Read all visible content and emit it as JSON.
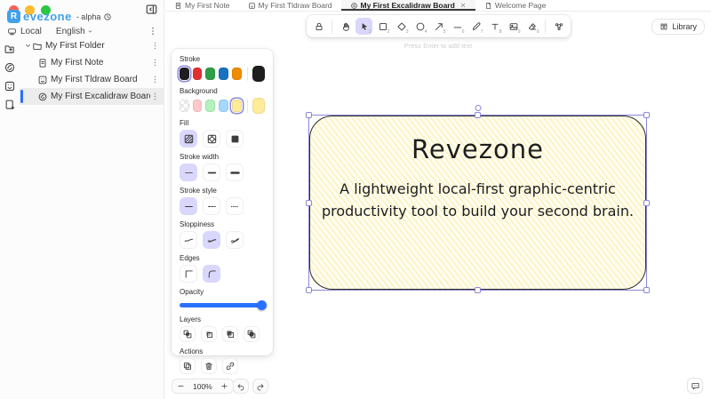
{
  "app": {
    "logo_letter": "R",
    "logo_text": "evezone",
    "version_label": "- alpha",
    "workspace_mode": "Local",
    "language": "English"
  },
  "sidebar": {
    "folder_label": "My First Folder",
    "rail_buttons": [
      {
        "name": "add-folder",
        "icon": "folder-plus"
      },
      {
        "name": "add-excalidraw",
        "icon": "excalidraw"
      },
      {
        "name": "add-tldraw",
        "icon": "tldraw"
      },
      {
        "name": "add-note",
        "icon": "note-plus"
      }
    ],
    "items": [
      {
        "label": "My First Note",
        "icon": "note",
        "selected": false
      },
      {
        "label": "My First Tldraw Board",
        "icon": "tldraw",
        "selected": false
      },
      {
        "label": "My First Excalidraw Board",
        "icon": "excalidraw",
        "selected": true
      }
    ]
  },
  "tabs": [
    {
      "label": "My First Note",
      "icon": "note",
      "active": false,
      "closable": false
    },
    {
      "label": "My First Tldraw Board",
      "icon": "tldraw",
      "active": false,
      "closable": false
    },
    {
      "label": "My First Excalidraw Board",
      "icon": "excalidraw",
      "active": true,
      "closable": true
    },
    {
      "label": "Welcome Page",
      "icon": "page",
      "active": false,
      "closable": false
    }
  ],
  "toolbar": {
    "left_group": [
      {
        "name": "lock",
        "icon": "lock",
        "shortcut": "",
        "active": false
      }
    ],
    "main_group": [
      {
        "name": "hand",
        "icon": "hand",
        "shortcut": "",
        "active": false
      },
      {
        "name": "selection",
        "icon": "mouse-pointer",
        "shortcut": "1",
        "active": true
      },
      {
        "name": "rectangle",
        "icon": "square",
        "shortcut": "2",
        "active": false
      },
      {
        "name": "diamond",
        "icon": "diamond",
        "shortcut": "3",
        "active": false
      },
      {
        "name": "ellipse",
        "icon": "circle",
        "shortcut": "4",
        "active": false
      },
      {
        "name": "arrow",
        "icon": "arrow",
        "shortcut": "5",
        "active": false
      },
      {
        "name": "line",
        "icon": "line",
        "shortcut": "6",
        "active": false
      },
      {
        "name": "draw",
        "icon": "pencil",
        "shortcut": "7",
        "active": false
      },
      {
        "name": "text",
        "icon": "text",
        "shortcut": "8",
        "active": false
      },
      {
        "name": "image",
        "icon": "image",
        "shortcut": "9",
        "active": false
      },
      {
        "name": "eraser",
        "icon": "eraser",
        "shortcut": "0",
        "active": false
      }
    ],
    "right_group": [
      {
        "name": "extra-tools",
        "icon": "shapes",
        "shortcut": "",
        "active": false
      }
    ],
    "library_label": "Library",
    "hint": "Press Enter to add text"
  },
  "panel": {
    "stroke": {
      "label": "Stroke",
      "swatches": [
        "#1e1e1e",
        "#e03131",
        "#2f9e44",
        "#1971c2",
        "#f08c00"
      ],
      "selected_index": 0,
      "current": "#1e1e1e"
    },
    "background": {
      "label": "Background",
      "swatches": [
        "transparent",
        "#ffc9c9",
        "#b2f2bb",
        "#a5d8ff",
        "#ffec99"
      ],
      "selected_index": 4,
      "current": "#ffec99"
    },
    "fill": {
      "label": "Fill",
      "options": [
        {
          "name": "hachure",
          "icon": "fill-hachure",
          "active": true
        },
        {
          "name": "cross-hatch",
          "icon": "fill-cross",
          "active": false
        },
        {
          "name": "solid",
          "icon": "fill-solid",
          "active": false
        }
      ]
    },
    "stroke_width": {
      "label": "Stroke width",
      "options": [
        {
          "name": "thin",
          "icon": "width-thin",
          "active": true
        },
        {
          "name": "bold",
          "icon": "width-bold",
          "active": false
        },
        {
          "name": "extra-bold",
          "icon": "width-extrabold",
          "active": false
        }
      ]
    },
    "stroke_style": {
      "label": "Stroke style",
      "options": [
        {
          "name": "solid",
          "icon": "style-solid",
          "active": true
        },
        {
          "name": "dashed",
          "icon": "style-dashed",
          "active": false
        },
        {
          "name": "dotted",
          "icon": "style-dotted",
          "active": false
        }
      ]
    },
    "sloppiness": {
      "label": "Sloppiness",
      "options": [
        {
          "name": "architect",
          "icon": "slop-architect",
          "active": false
        },
        {
          "name": "artist",
          "icon": "slop-artist",
          "active": true
        },
        {
          "name": "cartoonist",
          "icon": "slop-cartoonist",
          "active": false
        }
      ]
    },
    "edges": {
      "label": "Edges",
      "options": [
        {
          "name": "sharp",
          "icon": "edge-sharp",
          "active": false
        },
        {
          "name": "round",
          "icon": "edge-round",
          "active": true
        }
      ]
    },
    "opacity": {
      "label": "Opacity",
      "value": 100
    },
    "layers": {
      "label": "Layers",
      "options": [
        {
          "name": "send-to-back",
          "icon": "send-to-back",
          "active": false
        },
        {
          "name": "send-backward",
          "icon": "send-backward",
          "active": false
        },
        {
          "name": "bring-forward",
          "icon": "bring-forward",
          "active": false
        },
        {
          "name": "bring-to-front",
          "icon": "bring-to-front",
          "active": false
        }
      ]
    },
    "actions": {
      "label": "Actions",
      "options": [
        {
          "name": "duplicate",
          "icon": "duplicate",
          "active": false
        },
        {
          "name": "delete",
          "icon": "trash",
          "active": false
        },
        {
          "name": "link",
          "icon": "link",
          "active": false
        }
      ]
    }
  },
  "canvas": {
    "card": {
      "title": "Revezone",
      "desc_line1": "A lightweight local-first graphic-centric",
      "desc_line2": "productivity tool to build your second brain."
    }
  },
  "footer": {
    "zoom_level": "100%"
  },
  "colors": {
    "accent_blue": "#2970ff",
    "selection_purple": "#8b87d8",
    "active_option_bg": "#d9d7fb",
    "logo_blue": "#41a0e9",
    "card_fill": "#ffec99",
    "card_stroke": "#1e1e1e",
    "traffic_red": "#ff5f57",
    "traffic_yellow": "#febc2e",
    "traffic_green": "#28c840"
  }
}
